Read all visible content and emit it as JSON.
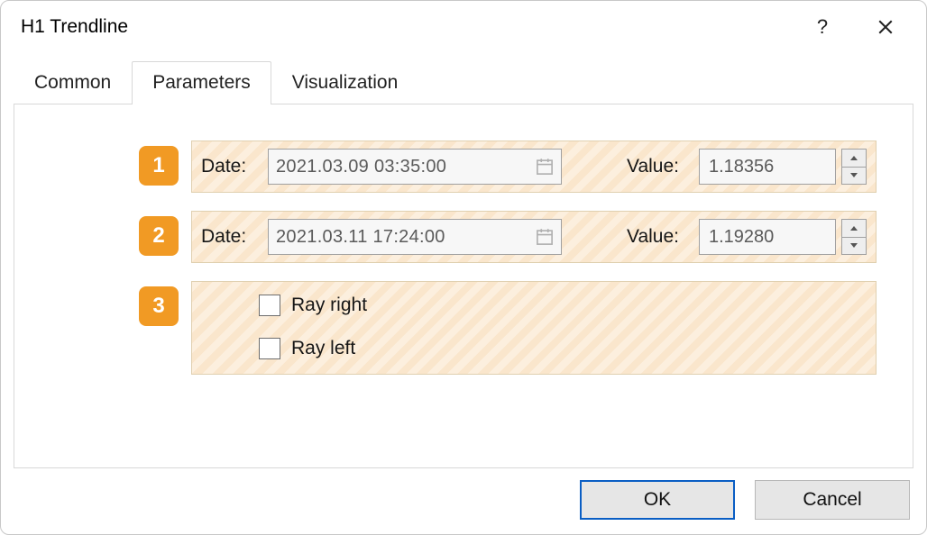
{
  "window": {
    "title": "H1 Trendline"
  },
  "tabs": {
    "common": "Common",
    "parameters": "Parameters",
    "visualization": "Visualization"
  },
  "labels": {
    "date": "Date:",
    "value": "Value:",
    "ray_right": "Ray right",
    "ray_left": "Ray left"
  },
  "markers": {
    "m1": "1",
    "m2": "2",
    "m3": "3"
  },
  "point1": {
    "date": "2021.03.09 03:35:00",
    "value": "1.18356"
  },
  "point2": {
    "date": "2021.03.11 17:24:00",
    "value": "1.19280"
  },
  "buttons": {
    "ok": "OK",
    "cancel": "Cancel",
    "help": "?"
  }
}
